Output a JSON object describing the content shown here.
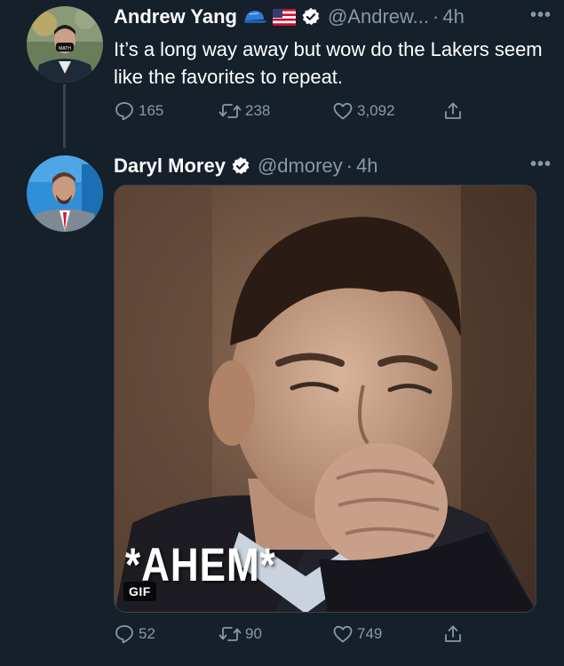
{
  "tweets": [
    {
      "author_name": "Andrew Yang",
      "badges": [
        "blue-cap-icon",
        "us-flag-icon",
        "verified-icon"
      ],
      "handle": "@Andrew...",
      "dot": "·",
      "time": "4h",
      "text": "It’s a long way away but wow do the Lakers seem like the favorites to repeat.",
      "replies": "165",
      "retweets": "238",
      "likes": "3,092"
    },
    {
      "author_name": "Daryl Morey",
      "badges": [
        "verified-icon"
      ],
      "handle": "@dmorey",
      "dot": "·",
      "time": "4h",
      "media": {
        "type": "gif",
        "caption": "*AHEM*",
        "gif_label": "GIF"
      },
      "replies": "52",
      "retweets": "90",
      "likes": "749"
    }
  ],
  "colors": {
    "background": "#15202b",
    "secondary_text": "#8899a6",
    "thread_line": "#38444d",
    "verified": "#ffffff"
  }
}
